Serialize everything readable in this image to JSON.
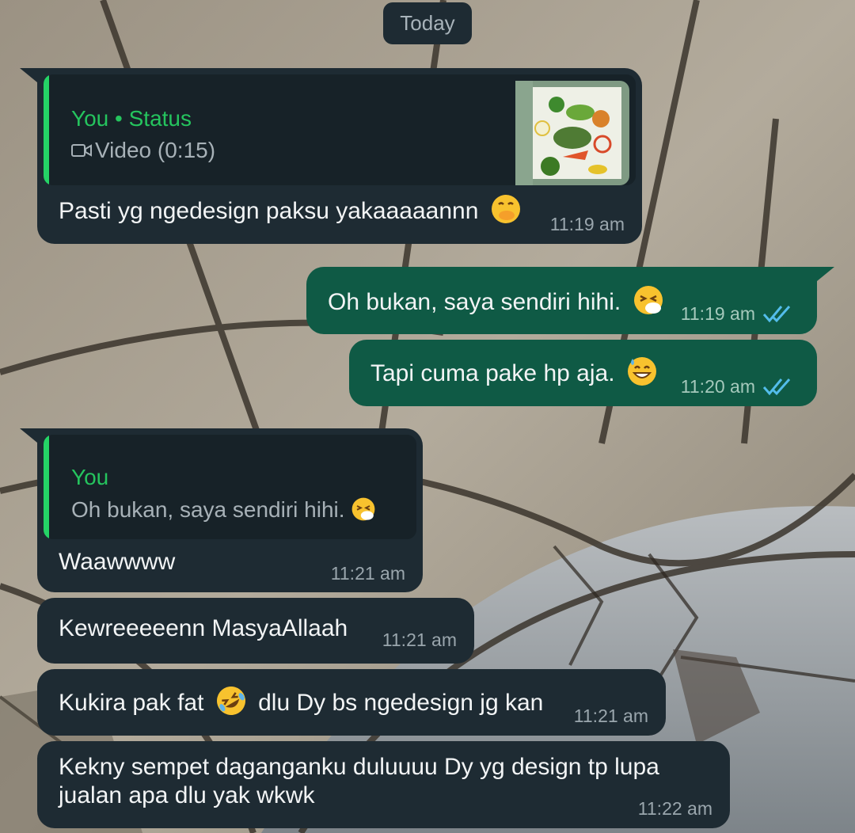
{
  "date_chip": "Today",
  "messages": [
    {
      "direction": "incoming",
      "quote": {
        "name": "You • Status",
        "text": "Video (0:15)",
        "icon": "video-camera-icon"
      },
      "text": "Pasti yg ngedesign paksu yakaaaaannn",
      "emoji": "face-with-hand-over-mouth",
      "time": "11:19 am"
    },
    {
      "direction": "outgoing",
      "text": "Oh bukan, saya sendiri hihi.",
      "emoji": "sneezing-face",
      "time": "11:19 am",
      "status": "read"
    },
    {
      "direction": "outgoing",
      "text": "Tapi cuma pake hp aja.",
      "emoji": "grinning-face-with-sweat",
      "time": "11:20 am",
      "status": "read"
    },
    {
      "direction": "incoming",
      "quote": {
        "name": "You",
        "text": "Oh bukan, saya sendiri hihi.",
        "emoji": "sneezing-face"
      },
      "text": "Waawwww",
      "time": "11:21 am"
    },
    {
      "direction": "incoming",
      "text": "Kewreeeeenn MasyaAllaah",
      "time": "11:21 am"
    },
    {
      "direction": "incoming",
      "text_before": "Kukira pak fat",
      "emoji": "rolling-on-the-floor-laughing",
      "text_after": "dlu Dy bs ngedesign jg kan",
      "time": "11:21 am"
    },
    {
      "direction": "incoming",
      "lines": [
        "Kekny sempet daganganku duluuuu Dy yg design tp lupa",
        "jualan apa dlu yak wkwk"
      ],
      "time": "11:22 am"
    }
  ],
  "colors": {
    "incoming_bubble": "#1e2b33",
    "outgoing_bubble": "#0f5a45",
    "quote_accent": "#25d366",
    "read_ticks": "#53bdeb"
  }
}
